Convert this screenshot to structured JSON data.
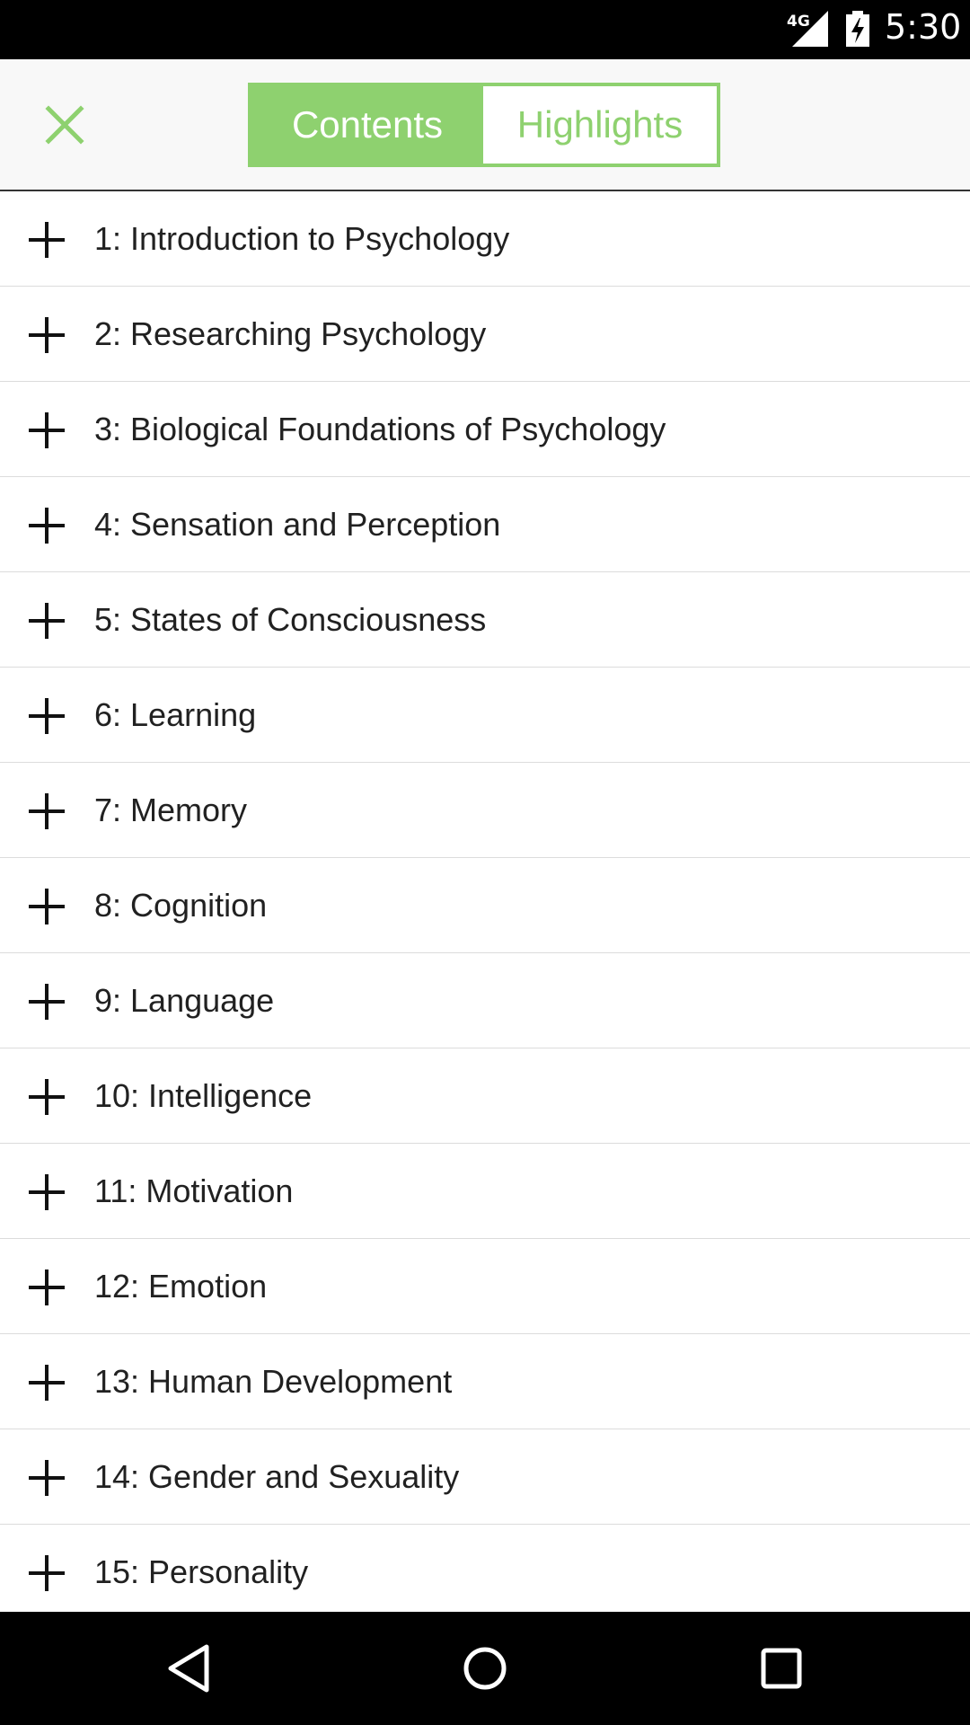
{
  "status_bar": {
    "network": "4G",
    "time": "5:30"
  },
  "header": {
    "close_icon": "close-icon",
    "tabs": [
      {
        "label": "Contents",
        "active": true
      },
      {
        "label": "Highlights",
        "active": false
      }
    ]
  },
  "colors": {
    "accent": "#8ed16f",
    "text": "#212121",
    "divider": "#dcdcdc",
    "system_bar": "#000000"
  },
  "toc": {
    "items": [
      {
        "label": "1: Introduction to Psychology"
      },
      {
        "label": "2: Researching Psychology"
      },
      {
        "label": "3: Biological Foundations of Psychology"
      },
      {
        "label": "4: Sensation and Perception"
      },
      {
        "label": "5: States of Consciousness"
      },
      {
        "label": "6: Learning"
      },
      {
        "label": "7: Memory"
      },
      {
        "label": "8: Cognition"
      },
      {
        "label": "9: Language"
      },
      {
        "label": "10: Intelligence"
      },
      {
        "label": "11: Motivation"
      },
      {
        "label": "12: Emotion"
      },
      {
        "label": "13: Human Development"
      },
      {
        "label": "14: Gender and Sexuality"
      },
      {
        "label": "15: Personality"
      }
    ]
  },
  "nav_bar": {
    "buttons": [
      "back-icon",
      "home-icon",
      "recents-icon"
    ]
  }
}
